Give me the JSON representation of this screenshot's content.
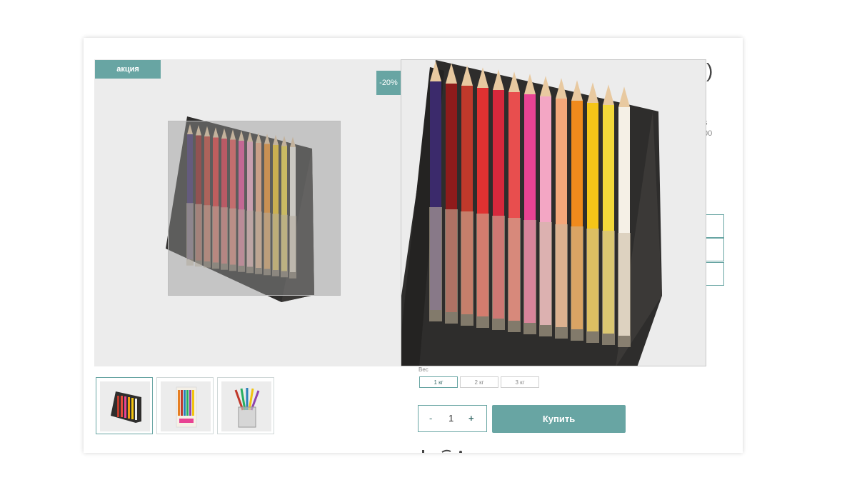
{
  "product": {
    "promo_badge": "акция",
    "discount_badge": "-20%"
  },
  "behind_text": {
    "title_fragment": ")",
    "meta_line_1": "s",
    "meta_line_2": "00"
  },
  "options": {
    "label": "Вес",
    "weights": [
      "1 кг",
      "2 кг",
      "3 кг"
    ],
    "selected_index": 0
  },
  "quantity": {
    "minus": "-",
    "value": "1",
    "plus": "+"
  },
  "buy_button": "Купить",
  "colors": {
    "accent": "#68a5a3",
    "image_bg": "#ececec"
  },
  "thumbnails": [
    "pencil-stand-thumb",
    "pencil-box-thumb",
    "pencil-cup-thumb"
  ]
}
